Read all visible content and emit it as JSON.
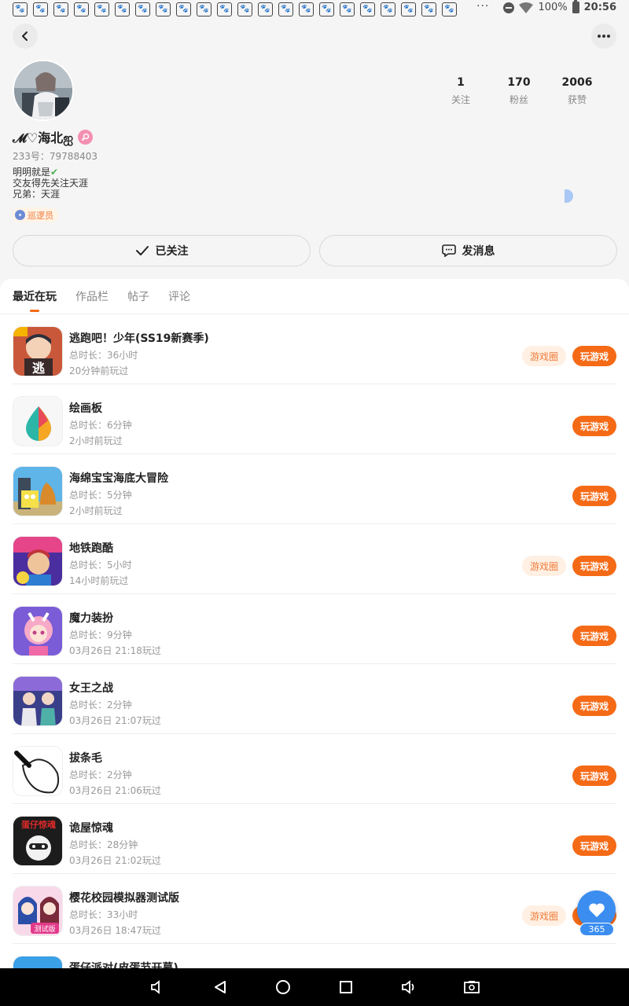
{
  "status_bar": {
    "notification_icon": "paw-icon",
    "notification_count": 22,
    "overflow": "···",
    "battery": "100%",
    "time": "20:56"
  },
  "profile": {
    "nickname": "𝓜♡海北ஐ",
    "uid": "233号：79788403",
    "bio": [
      "明明就是",
      "交友得先关注天涯",
      "兄弟：天涯"
    ],
    "badge": "巡逻员",
    "stats": [
      {
        "num": "1",
        "label": "关注"
      },
      {
        "num": "170",
        "label": "粉丝"
      },
      {
        "num": "2006",
        "label": "获赞"
      }
    ],
    "follow_label": "已关注",
    "message_label": "发消息"
  },
  "tabs": [
    "最近在玩",
    "作品栏",
    "帖子",
    "评论"
  ],
  "games": [
    {
      "name": "逃跑吧！少年(SS19新赛季)",
      "duration": "总时长：36小时",
      "last": "20分钟前玩过",
      "circle": "游戏圈",
      "play": "玩游戏"
    },
    {
      "name": "绘画板",
      "duration": "总时长：6分钟",
      "last": "2小时前玩过",
      "circle": "",
      "play": "玩游戏"
    },
    {
      "name": "海绵宝宝海底大冒险",
      "duration": "总时长：5分钟",
      "last": "2小时前玩过",
      "circle": "",
      "play": "玩游戏"
    },
    {
      "name": "地铁跑酷",
      "duration": "总时长：5小时",
      "last": "14小时前玩过",
      "circle": "游戏圈",
      "play": "玩游戏"
    },
    {
      "name": "魔力装扮",
      "duration": "总时长：9分钟",
      "last": "03月26日 21:18玩过",
      "circle": "",
      "play": "玩游戏"
    },
    {
      "name": "女王之战",
      "duration": "总时长：2分钟",
      "last": "03月26日 21:07玩过",
      "circle": "",
      "play": "玩游戏"
    },
    {
      "name": "拔条毛",
      "duration": "总时长：2分钟",
      "last": "03月26日 21:06玩过",
      "circle": "",
      "play": "玩游戏"
    },
    {
      "name": "诡屋惊魂",
      "duration": "总时长：28分钟",
      "last": "03月26日 21:02玩过",
      "circle": "",
      "play": "玩游戏"
    },
    {
      "name": "樱花校园模拟器测试版",
      "duration": "总时长：33小时",
      "last": "03月26日 18:47玩过",
      "circle": "游戏圈",
      "play": "玩游戏"
    },
    {
      "name": "蛋仔派对(皮蛋节开幕)",
      "duration": "",
      "last": "",
      "circle": "",
      "play": ""
    }
  ],
  "icon_texts": {
    "icon_1": "逃",
    "icon_8": "蛋仔惊魂",
    "icon_9": "测试版"
  },
  "fab": {
    "count": "365"
  },
  "colors": {
    "accent": "#f56a16",
    "circle_tag_bg": "#fff0e3",
    "fab": "#3b8ef0"
  }
}
